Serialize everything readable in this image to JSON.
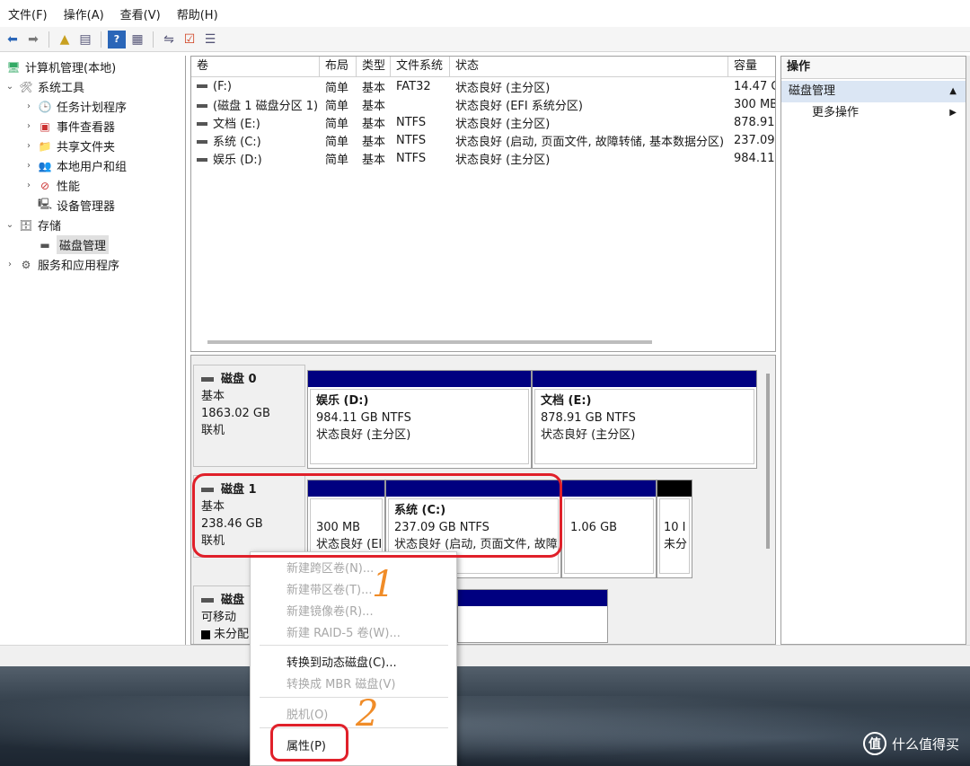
{
  "menubar": {
    "items": [
      "文件(F)",
      "操作(A)",
      "查看(V)",
      "帮助(H)"
    ]
  },
  "tree": {
    "root": "计算机管理(本地)",
    "system_tools": "系统工具",
    "task_scheduler": "任务计划程序",
    "event_viewer": "事件查看器",
    "shared_folders": "共享文件夹",
    "local_users": "本地用户和组",
    "performance": "性能",
    "device_manager": "设备管理器",
    "storage": "存储",
    "disk_management": "磁盘管理",
    "services": "服务和应用程序"
  },
  "volume_list": {
    "headers": [
      "卷",
      "布局",
      "类型",
      "文件系统",
      "状态",
      "容量"
    ],
    "rows": [
      [
        "(F:)",
        "简单",
        "基本",
        "FAT32",
        "状态良好 (主分区)",
        "14.47 G"
      ],
      [
        "(磁盘 1 磁盘分区 1)",
        "简单",
        "基本",
        "",
        "状态良好 (EFI 系统分区)",
        "300 MB"
      ],
      [
        "文档 (E:)",
        "简单",
        "基本",
        "NTFS",
        "状态良好 (主分区)",
        "878.91"
      ],
      [
        "系统 (C:)",
        "简单",
        "基本",
        "NTFS",
        "状态良好 (启动, 页面文件, 故障转储, 基本数据分区)",
        "237.09"
      ],
      [
        "娱乐 (D:)",
        "简单",
        "基本",
        "NTFS",
        "状态良好 (主分区)",
        "984.11"
      ]
    ]
  },
  "disk0": {
    "name": "磁盘 0",
    "type": "基本",
    "size": "1863.02 GB",
    "status": "联机",
    "partitions": [
      {
        "name": "娱乐 (D:)",
        "size": "984.11 GB NTFS",
        "status": "状态良好 (主分区)"
      },
      {
        "name": "文档 (E:)",
        "size": "878.91 GB NTFS",
        "status": "状态良好 (主分区)"
      }
    ]
  },
  "disk1": {
    "name": "磁盘 1",
    "type": "基本",
    "size": "238.46 GB",
    "status": "联机",
    "partitions": [
      {
        "size": "300 MB",
        "status": "状态良好 (EI"
      },
      {
        "name": "系统 (C:)",
        "size": "237.09 GB NTFS",
        "status": "状态良好 (启动, 页面文件, 故障"
      },
      {
        "size": "1.06 GB"
      },
      {
        "size": "10 I",
        "status": "未分"
      }
    ]
  },
  "disk2": {
    "name": "磁盘",
    "type": "可移动",
    "status": "未分配"
  },
  "actions": {
    "header": "操作",
    "section": "磁盘管理",
    "more": "更多操作"
  },
  "context_menu": {
    "items": [
      "新建跨区卷(N)...",
      "新建带区卷(T)...",
      "新建镜像卷(R)...",
      "新建 RAID-5 卷(W)...",
      "转换到动态磁盘(C)...",
      "转换成 MBR 磁盘(V)",
      "脱机(O)",
      "属性(P)"
    ]
  },
  "annotations": {
    "step1": "1",
    "step2": "2"
  },
  "watermark": {
    "logo": "值",
    "text": "什么值得买"
  },
  "colors": {
    "partition_bar": "#000080",
    "annotation_red": "#e0202a",
    "annotation_orange": "#f08c28"
  }
}
